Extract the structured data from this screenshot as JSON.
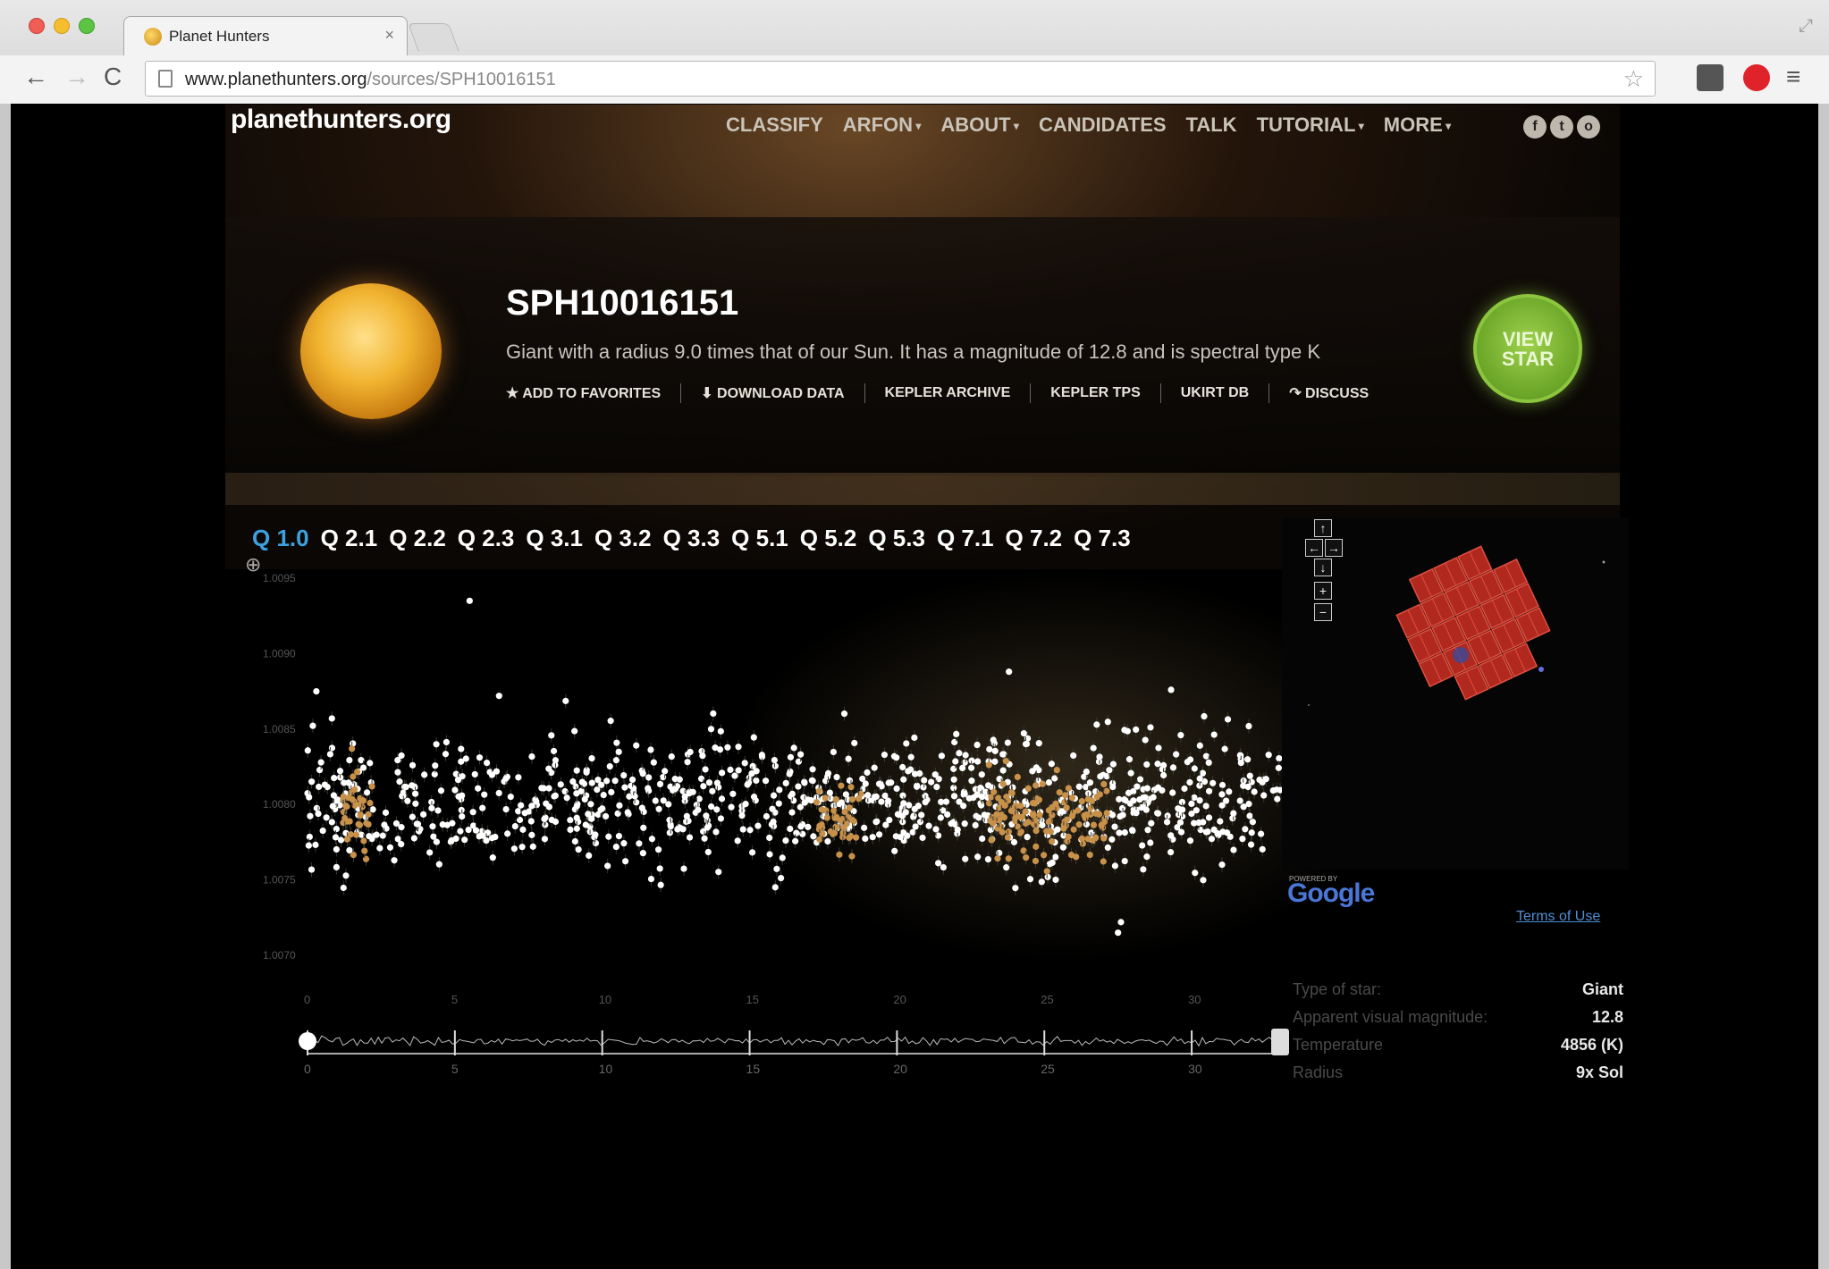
{
  "browser": {
    "tab_title": "Planet Hunters",
    "tab_close": "×",
    "url_host": "www.planethunters.org",
    "url_path": "/sources/SPH10016151",
    "back": "←",
    "forward": "→",
    "reload": "C",
    "star": "☆",
    "menu": "≡"
  },
  "site": {
    "logo": "planethunters.org",
    "nav": [
      "CLASSIFY",
      "ARFON",
      "ABOUT",
      "CANDIDATES",
      "TALK",
      "TUTORIAL",
      "MORE"
    ],
    "nav_dropdowns": [
      false,
      true,
      true,
      false,
      false,
      true,
      true
    ],
    "social": [
      "f",
      "t",
      "o"
    ]
  },
  "star": {
    "name": "SPH10016151",
    "description": "Giant with a radius 9.0 times that of our Sun. It has a magnitude of 12.8 and is spectral type K",
    "actions": [
      "★ ADD TO FAVORITES",
      "⬇ DOWNLOAD DATA",
      "KEPLER ARCHIVE",
      "KEPLER TPS",
      "UKIRT DB",
      "↷ DISCUSS"
    ],
    "view_button": [
      "VIEW",
      "STAR"
    ]
  },
  "quarters": {
    "tabs": [
      "Q 1.0",
      "Q 2.1",
      "Q 2.2",
      "Q 2.3",
      "Q 3.1",
      "Q 3.2",
      "Q 3.3",
      "Q 5.1",
      "Q 5.2",
      "Q 5.3",
      "Q 7.1",
      "Q 7.2",
      "Q 7.3"
    ],
    "active": "Q 1.0"
  },
  "chart_data": {
    "type": "scatter",
    "title": "",
    "xlabel": "",
    "ylabel": "",
    "ylim": [
      1.007,
      1.0095
    ],
    "xlim": [
      0,
      33
    ],
    "y_ticks": [
      "1.0095",
      "1.0090",
      "1.0085",
      "1.0080",
      "1.0075",
      "1.0070"
    ],
    "x_ticks": [
      0,
      5,
      10,
      15,
      20,
      25,
      30
    ],
    "x_ticks_bottom": [
      0,
      5,
      10,
      15,
      20,
      25,
      30
    ],
    "series": [
      {
        "name": "",
        "color": "#ffffff",
        "x_range": [
          0,
          33
        ],
        "y_center": 1.00802,
        "y_spread": 0.00045,
        "count": 900
      },
      {
        "name": "",
        "color": "#c8914a",
        "x_range": [
          1.2,
          2.2
        ],
        "y_center": 1.00795,
        "y_spread": 0.0003,
        "count": 40
      },
      {
        "name": "",
        "color": "#c8914a",
        "x_range": [
          17.2,
          18.8
        ],
        "y_center": 1.0079,
        "y_spread": 0.00025,
        "count": 45
      },
      {
        "name": "",
        "color": "#c8914a",
        "x_range": [
          23.0,
          27.2
        ],
        "y_center": 1.0079,
        "y_spread": 0.0003,
        "count": 130
      }
    ],
    "outliers": [
      {
        "x": 5.5,
        "y": 1.00935
      },
      {
        "x": 23.8,
        "y": 1.00888
      },
      {
        "x": 0.3,
        "y": 1.00875
      },
      {
        "x": 6.5,
        "y": 1.00872
      },
      {
        "x": 29.3,
        "y": 1.00876
      },
      {
        "x": 27.6,
        "y": 1.00722
      },
      {
        "x": 27.5,
        "y": 1.00715
      }
    ]
  },
  "map": {
    "controls": [
      "↑",
      "←",
      "→",
      "↓",
      "+",
      "−"
    ],
    "powered_by": "POWERED BY",
    "google": "Google",
    "terms": "Terms of Use"
  },
  "facts": [
    {
      "label": "Type of star:",
      "value": "Giant"
    },
    {
      "label": "Apparent visual magnitude:",
      "value": "12.8"
    },
    {
      "label": "Temperature",
      "value": "4856 (K)"
    },
    {
      "label": "Radius",
      "value": "9x Sol"
    }
  ]
}
